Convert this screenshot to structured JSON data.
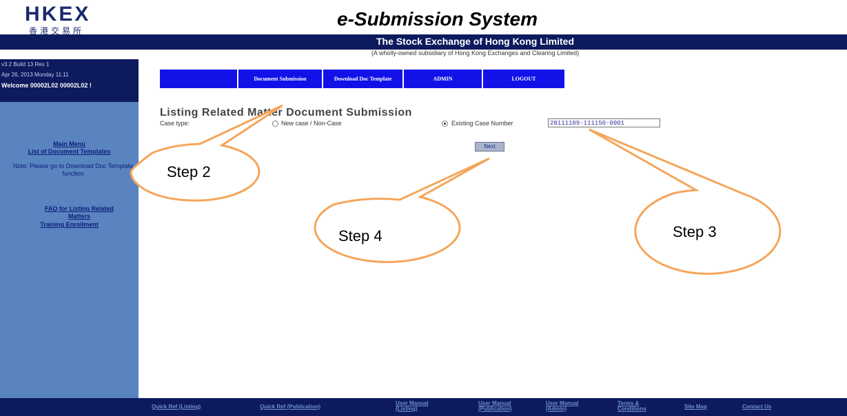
{
  "header": {
    "logo_text": "HKEX",
    "logo_chinese": "香港交易所",
    "app_title": "e-Submission System",
    "org_name": "The Stock Exchange of Hong Kong Limited",
    "org_subtitle": "(A wholly-owned subsidiary of Hong Kong Exchanges and Clearing Limited)"
  },
  "sidebar_info": {
    "build": "v3.2 Build 13 Rev 1",
    "datetime": "Apr 26, 2013 Monday 11:11",
    "welcome": "Welcome 00002L02 00002L02 !"
  },
  "sidebar": {
    "main_menu": "Main Menu",
    "doc_templates": "List of Document Templates",
    "note": "Note: Please go to Download Doc Template function",
    "faq": "FAQ for Listing Related Matters",
    "training": "Training Enrollment"
  },
  "nav": [
    {
      "label": "Document Submission"
    },
    {
      "label": "Download Doc Template"
    },
    {
      "label": "ADMIN"
    },
    {
      "label": "LOGOUT"
    }
  ],
  "page_title": "Listing Related Matter Document Submission",
  "form": {
    "case_type_label": "Case type:",
    "option_new": "New case / Non-Case",
    "option_existing": "Existing Case Number",
    "case_number": "20111109-111150-0001",
    "selected": "existing",
    "next_button": "Next"
  },
  "footer": [
    {
      "label": "Quick Ref (Listing)"
    },
    {
      "label": "Quick Ref (Publication)"
    },
    {
      "label": "User Manual (Listing)"
    },
    {
      "label": "User Manual (Publication)"
    },
    {
      "label": "User Manual (Admin)"
    },
    {
      "label": "Terms & Conditions"
    },
    {
      "label": "Site Map"
    },
    {
      "label": "Contact Us"
    }
  ],
  "callouts": [
    {
      "label": "Step 2"
    },
    {
      "label": "Step 4"
    },
    {
      "label": "Step 3"
    }
  ],
  "colors": {
    "header_navy": "#0d1a5e",
    "sidebar_blue": "#5a84c0",
    "nav_blue": "#1212e8",
    "callout_orange": "#f5a55a"
  }
}
